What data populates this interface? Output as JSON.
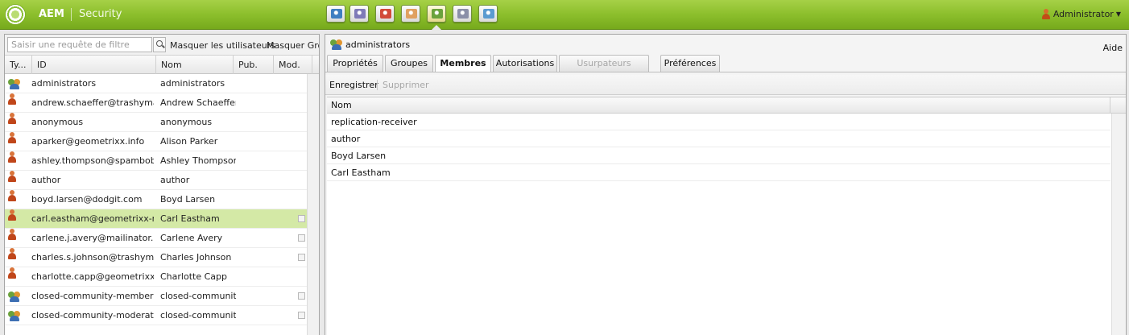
{
  "app": {
    "brand": "AEM",
    "section": "Security"
  },
  "topbar": {
    "tools": [
      {
        "name": "websites-icon",
        "color": "#3f7fc1"
      },
      {
        "name": "digital-assets-icon",
        "color": "#7f7ab8"
      },
      {
        "name": "campaigns-icon",
        "color": "#d24a3a"
      },
      {
        "name": "inbox-icon",
        "color": "#e0a060"
      },
      {
        "name": "users-icon",
        "color": "#6aa23c"
      },
      {
        "name": "tools-gear-icon",
        "color": "#8b8fa8"
      },
      {
        "name": "tagging-icon",
        "color": "#5b9bd0"
      }
    ],
    "user": "Administrator"
  },
  "left": {
    "filter_placeholder": "Saisir une requête de filtre",
    "hide_users": "Masquer les utilisateurs",
    "hide_groups": "Masquer Grou",
    "columns": {
      "type": "Ty...",
      "id": "ID",
      "name": "Nom",
      "pub": "Pub.",
      "mod": "Mod."
    },
    "rows": [
      {
        "type": "group",
        "id": "administrators",
        "name": "administrators",
        "checkbox": false
      },
      {
        "type": "user",
        "id": "andrew.schaeffer@trashyma...",
        "name": "Andrew Schaeffer",
        "checkbox": false
      },
      {
        "type": "user",
        "id": "anonymous",
        "name": "anonymous",
        "checkbox": false
      },
      {
        "type": "user",
        "id": "aparker@geometrixx.info",
        "name": "Alison Parker",
        "checkbox": false
      },
      {
        "type": "user",
        "id": "ashley.thompson@spambob....",
        "name": "Ashley Thompson",
        "checkbox": false
      },
      {
        "type": "user",
        "id": "author",
        "name": "author",
        "checkbox": false
      },
      {
        "type": "user",
        "id": "boyd.larsen@dodgit.com",
        "name": "Boyd Larsen",
        "checkbox": false
      },
      {
        "type": "user",
        "id": "carl.eastham@geometrixx-m...",
        "name": "Carl Eastham",
        "checkbox": true,
        "selected": true
      },
      {
        "type": "user",
        "id": "carlene.j.avery@mailinator.c...",
        "name": "Carlene Avery",
        "checkbox": true
      },
      {
        "type": "user",
        "id": "charles.s.johnson@trashyma...",
        "name": "Charles Johnson",
        "checkbox": true
      },
      {
        "type": "user",
        "id": "charlotte.capp@geometrixx-...",
        "name": "Charlotte Capp",
        "checkbox": false
      },
      {
        "type": "group",
        "id": "closed-community-members",
        "name": "closed-communit...",
        "checkbox": true
      },
      {
        "type": "group",
        "id": "closed-community-moderators",
        "name": "closed-communit...",
        "checkbox": true
      }
    ]
  },
  "right": {
    "title": "administrators",
    "help": "Aide",
    "tabs": [
      {
        "label": "Propriétés",
        "state": "normal"
      },
      {
        "label": "Groupes",
        "state": "normal"
      },
      {
        "label": "Membres",
        "state": "active"
      },
      {
        "label": "Autorisations",
        "state": "normal"
      },
      {
        "label": "Usurpateurs d'identité",
        "state": "disabled"
      },
      {
        "label": "Préférences",
        "state": "normal"
      }
    ],
    "toolbar": {
      "save": "Enregistrer",
      "delete": "Supprimer"
    },
    "members_column": "Nom",
    "members": [
      "replication-receiver",
      "author",
      "Boyd Larsen",
      "Carl Eastham"
    ]
  }
}
